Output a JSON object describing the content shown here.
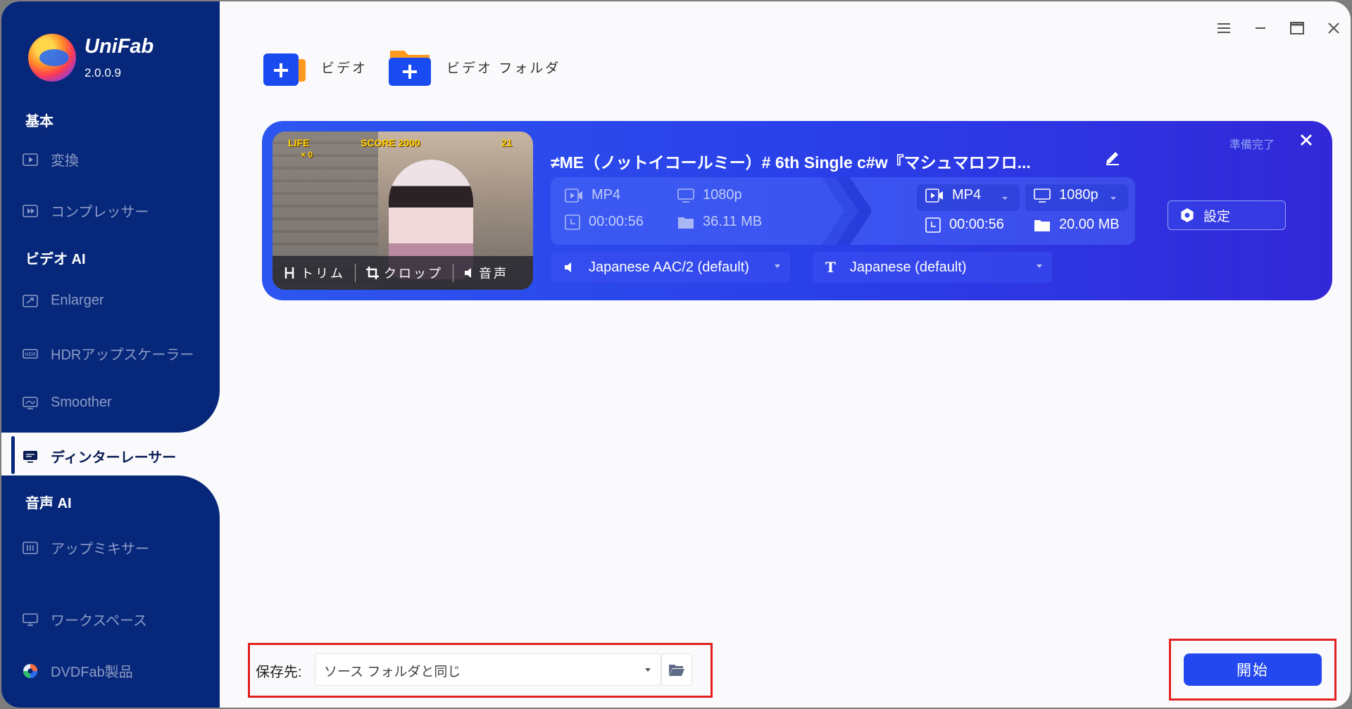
{
  "app": {
    "name": "UniFab",
    "version": "2.0.0.9"
  },
  "sidebar": {
    "sections": [
      {
        "title": "基本",
        "items": [
          {
            "label": "変換",
            "icon": "play-square-icon"
          },
          {
            "label": "コンプレッサー",
            "icon": "compress-icon"
          }
        ]
      },
      {
        "title": "ビデオ AI",
        "items": [
          {
            "label": "Enlarger",
            "icon": "enlarge-icon"
          },
          {
            "label": "HDRアップスケーラー",
            "icon": "hdr-icon"
          },
          {
            "label": "Smoother",
            "icon": "smoother-icon"
          },
          {
            "label": "ディンターレーサー",
            "icon": "deinterlace-icon",
            "active": true
          }
        ]
      },
      {
        "title": "音声 AI",
        "items": [
          {
            "label": "アップミキサー",
            "icon": "mixer-icon"
          }
        ]
      }
    ],
    "footer": [
      {
        "label": "ワークスペース",
        "icon": "monitor-icon"
      },
      {
        "label": "DVDFab製品",
        "icon": "dvdfab-icon"
      }
    ]
  },
  "toolbar": {
    "add_video": "ビデオ",
    "add_folder": "ビデオ フォルダ"
  },
  "task": {
    "title": "≠ME（ノットイコールミー）# 6th Single c#w『マシュマロフロ...",
    "status": "準備完了",
    "thumb": {
      "hud_left": "LIFE",
      "hud_count": "× 0",
      "hud_score": "SCORE 2000",
      "hud_time": "21",
      "trim": "トリム",
      "crop": "クロップ",
      "audio": "音声"
    },
    "source": {
      "format": "MP4",
      "resolution": "1080p",
      "duration": "00:00:56",
      "size": "36.11 MB"
    },
    "output": {
      "format": "MP4",
      "resolution": "1080p",
      "duration": "00:00:56",
      "size": "20.00 MB"
    },
    "audio_track": "Japanese AAC/2 (default)",
    "subtitle": "Japanese (default)",
    "settings_label": "設定"
  },
  "bottom": {
    "save_label": "保存先:",
    "save_value": "ソース フォルダと同じ",
    "start_label": "開始"
  },
  "colors": {
    "sidebar": "#07287a",
    "card": "#2d56f0",
    "start": "#2348f0",
    "highlight": "#e32020"
  }
}
